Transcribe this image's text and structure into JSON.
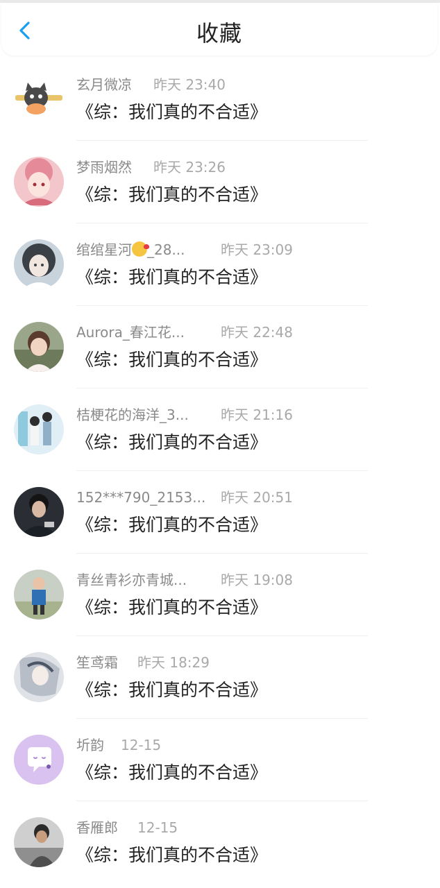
{
  "header": {
    "title": "收藏",
    "back_icon": "chevron-left-icon",
    "accent": "#1aa0f0"
  },
  "items": [
    {
      "name": "玄月微凉",
      "time": "昨天 23:40",
      "message": "《综：我们真的不合适》",
      "avatar": "cartoon-cat-avatar"
    },
    {
      "name": "梦雨烟然",
      "time": "昨天 23:26",
      "message": "《综：我们真的不合适》",
      "avatar": "anime-girl-pink-avatar"
    },
    {
      "name": "绾绾星河",
      "name_suffix": "_28...",
      "time": "昨天 23:09",
      "message": "《综：我们真的不合适》",
      "avatar": "anime-girl-dark-avatar",
      "emoji": "kiss-emoji"
    },
    {
      "name": "Aurora_春江花...",
      "time": "昨天 22:48",
      "message": "《综：我们真的不合适》",
      "avatar": "child-photo-avatar"
    },
    {
      "name": "桔梗花的海洋_3...",
      "time": "昨天 21:16",
      "message": "《综：我们真的不合适》",
      "avatar": "couple-illustration-avatar"
    },
    {
      "name": "152***790_2153...",
      "time": "昨天 20:51",
      "message": "《综：我们真的不合适》",
      "avatar": "man-photo-avatar"
    },
    {
      "name": "青丝青衫亦青城...",
      "time": "昨天 19:08",
      "message": "《综：我们真的不合适》",
      "avatar": "kid-outdoor-avatar"
    },
    {
      "name": "笙鸢霜",
      "time": "昨天 18:29",
      "message": "《综：我们真的不合适》",
      "avatar": "anime-boy-silver-avatar"
    },
    {
      "name": "圻韵",
      "time": "12-15",
      "message": "《综：我们真的不合适》",
      "avatar": "chat-bubble-avatar"
    },
    {
      "name": "香雁郎",
      "time": "12-15",
      "message": "《综：我们真的不合适》",
      "avatar": "person-photo-avatar"
    }
  ]
}
